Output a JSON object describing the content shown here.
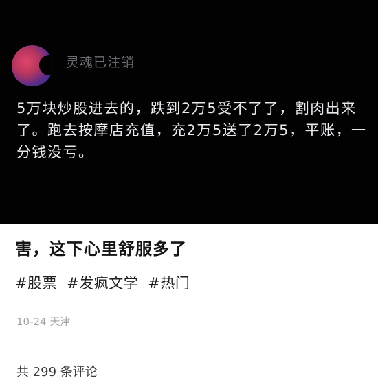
{
  "post": {
    "username": "灵魂已注销",
    "text": "5万块炒股进去的，跌到2万5受不了了，割肉出来了。跑去按摩店充值，充2万5送了2万5，平账，一分钱没亏。"
  },
  "caption": "害，这下心里舒服多了",
  "tags": [
    "#股票",
    "#发疯文学",
    "#热门"
  ],
  "meta": {
    "date_location": "10-24 天津"
  },
  "comments": {
    "count_text": "共 299 条评论"
  }
}
